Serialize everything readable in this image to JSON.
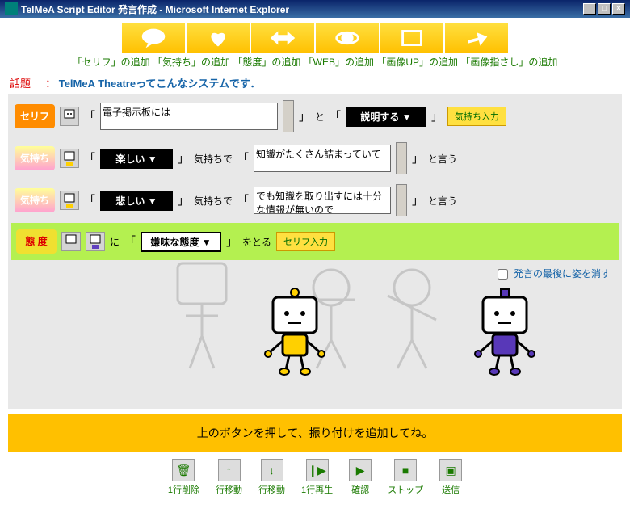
{
  "window": {
    "title": "TelMeA Script Editor 発言作成 - Microsoft Internet Explorer"
  },
  "toolbar": {
    "labels": "「セリフ」の追加 「気持ち」の追加 「態度」の追加 「WEB」の追加 「画像UP」の追加 「画像指さし」の追加"
  },
  "topic": {
    "label": "話題",
    "sep": "：",
    "text": "TelMeA Theatreってこんなシステムです．"
  },
  "rows": {
    "serifu": {
      "tag": "セリフ",
      "text": "電子掲示板には",
      "conj": "と",
      "action": "説明する ▼",
      "btn": "気持ち入力"
    },
    "kimochi1": {
      "tag": "気持ち",
      "feel": "楽しい ▼",
      "mid": "気持ちで",
      "text": "知識がたくさん詰まっていて",
      "suf": "と言う"
    },
    "kimochi2": {
      "tag": "気持ち",
      "feel": "悲しい ▼",
      "mid": "気持ちで",
      "text": "でも知識を取り出すには十分な情報が無いので",
      "suf": "と言う"
    },
    "taido": {
      "tag": "態 度",
      "pre": "に",
      "att": "嫌味な態度 ▼",
      "suf": "をとる",
      "btn": "セリフ入力"
    }
  },
  "checkbox": {
    "label": "発言の最後に姿を消す"
  },
  "yellowbar": {
    "text": "上のボタンを押して、振り付けを追加してね。"
  },
  "bottom": {
    "b1": "1行削除",
    "b2": "行移動",
    "b3": "行移動",
    "b4": "1行再生",
    "b5": "確認",
    "b6": "ストップ",
    "b7": "送信"
  },
  "icons": {
    "trash": "🗑",
    "up": "↑",
    "down": "↓",
    "stepplay": "❙▶",
    "play": "▶",
    "stop": "■",
    "send": "▣"
  }
}
